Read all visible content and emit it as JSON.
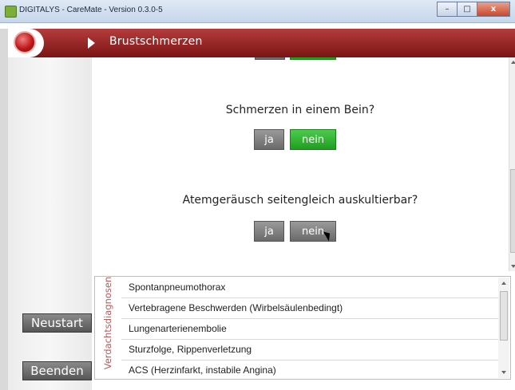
{
  "window": {
    "title": "DIGITALYS - CareMate - Version 0.3.0-5",
    "min_label": "–",
    "max_label": "□",
    "close_label": "x"
  },
  "header": {
    "breadcrumb": "Brustschmerzen",
    "brand_color": "#9b2a2a"
  },
  "sidebar": {
    "restart_label": "Neustart",
    "quit_label": "Beenden"
  },
  "questions": [
    {
      "text": "",
      "yes_label": "",
      "no_label": "",
      "selected": "nein"
    },
    {
      "text": "Schmerzen in einem Bein?",
      "yes_label": "ja",
      "no_label": "nein",
      "selected": "nein"
    },
    {
      "text": "Atemgeräusch seitengleich auskultierbar?",
      "yes_label": "ja",
      "no_label": "nein",
      "selected": "none"
    }
  ],
  "diagnoses": {
    "heading": "Verdachtsdiagnosen",
    "items": [
      "Spontanpneumothorax",
      "Vertebragene Beschwerden (Wirbelsäulenbedingt)",
      "Lungenarterienembolie",
      "Sturzfolge, Rippenverletzung",
      "ACS (Herzinfarkt, instabile Angina)"
    ]
  },
  "colors": {
    "selected_green": "#2db52d",
    "neutral_grey": "#7a7a7a",
    "accent_red": "#b53c3c"
  }
}
